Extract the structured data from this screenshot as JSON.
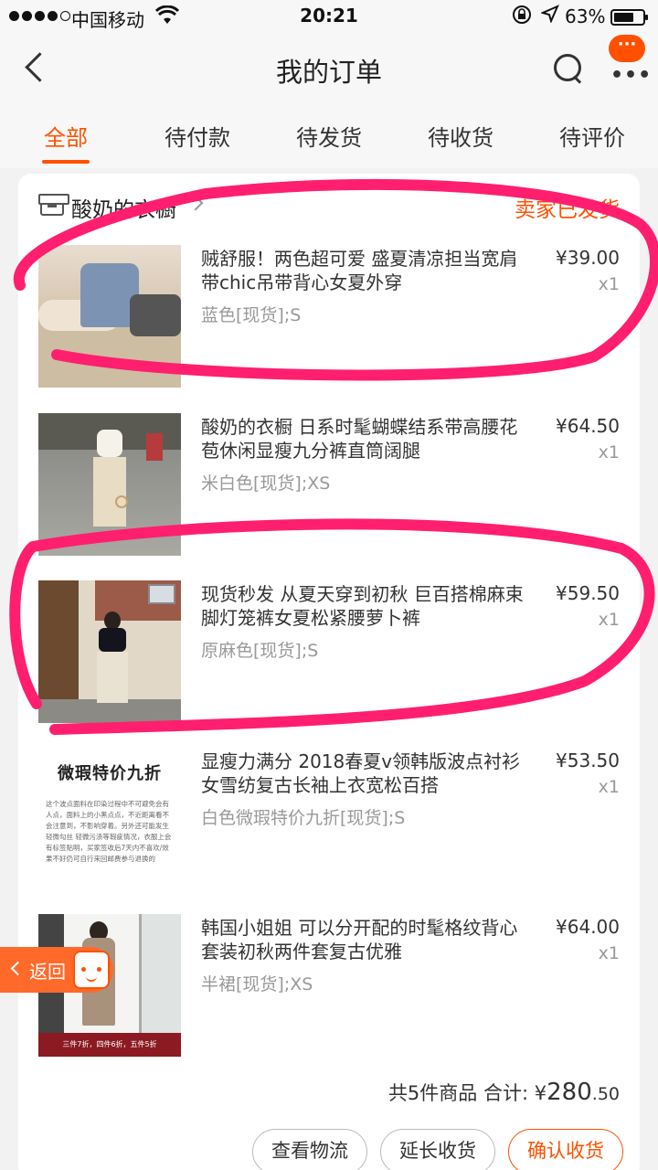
{
  "status_bar": {
    "carrier": "中国移动",
    "time": "20:21",
    "battery_pct": "63%"
  },
  "nav": {
    "title": "我的订单",
    "more_bubble": "···"
  },
  "tabs": [
    {
      "label": "全部",
      "active": true
    },
    {
      "label": "待付款",
      "active": false
    },
    {
      "label": "待发货",
      "active": false
    },
    {
      "label": "待收货",
      "active": false
    },
    {
      "label": "待评价",
      "active": false
    }
  ],
  "order": {
    "shop_name": "酸奶的衣橱",
    "status": "卖家已发货",
    "items": [
      {
        "title": "贼舒服！两色超可爱 盛夏清凉担当宽肩带chic吊带背心女夏外穿",
        "spec": "蓝色[现货];S",
        "price": "¥39.00",
        "qty": "x1"
      },
      {
        "title": "酸奶的衣橱 日系时髦蝴蝶结系带高腰花苞休闲显瘦九分裤直筒阔腿",
        "spec": "米白色[现货];XS",
        "price": "¥64.50",
        "qty": "x1"
      },
      {
        "title": "现货秒发 从夏天穿到初秋 巨百搭棉麻束脚灯笼裤女夏松紧腰萝卜裤",
        "spec": "原麻色[现货];S",
        "price": "¥59.50",
        "qty": "x1"
      },
      {
        "title": "显瘦力满分 2018春夏v领韩版波点衬衫女雪纺复古长袖上衣宽松百搭",
        "spec": "白色微瑕特价九折[现货];S",
        "price": "¥53.50",
        "qty": "x1",
        "thumb_heading": "微瑕特价九折",
        "thumb_text": "这个波点面料在印染过程中不可避免会有人点，面料上的小黑点点，不近距离看不会注意到，不影响穿着。另外还可能发生轻微勾丝 轻微污渍等瑕疵情况，衣服上会有标签贴明，买家签收后7天内不喜欢/效果不好仍可自行来回邮费参与退换的"
      },
      {
        "title": "韩国小姐姐 可以分开配的时髦格纹背心套装初秋两件套复古优雅",
        "spec": "半裙[现货];XS",
        "price": "¥64.00",
        "qty": "x1",
        "thumb_banner": "三件7折，四件6折，五件5折"
      }
    ],
    "total_count_text": "共5件商品",
    "total_label": "合计:",
    "total_currency": "¥",
    "total_int": "280",
    "total_dec": ".50",
    "actions": [
      "查看物流",
      "延长收货",
      "确认收货"
    ]
  },
  "float_back": {
    "label": "返回"
  },
  "colors": {
    "accent": "#ff5000",
    "annotation": "#ff1f6e"
  }
}
